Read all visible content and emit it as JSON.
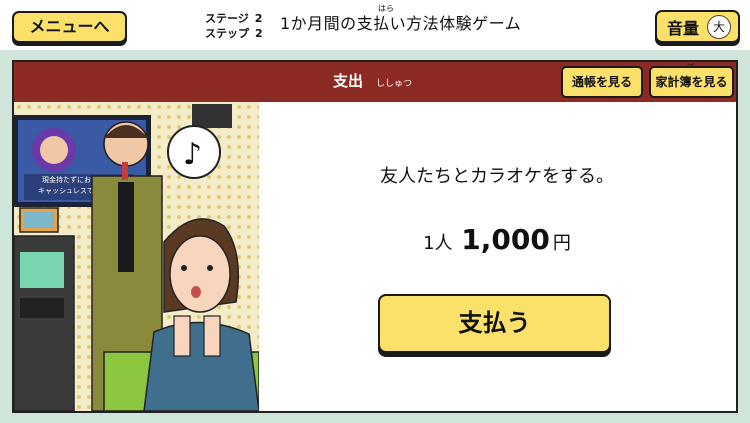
{
  "header": {
    "menu_label": "メニューへ",
    "stage_label": "ステージ",
    "stage_number": "2",
    "step_label": "ステップ",
    "step_number": "2",
    "title": "1か月間の支払い方法体験ゲーム",
    "title_ruby": "はら",
    "volume_label": "音量",
    "volume_value": "大"
  },
  "panel": {
    "title": "支出",
    "title_ruby": "ししゅつ",
    "passbook_label": "通帳を見る",
    "ledger_label": "家計簿を見る",
    "ledger_ruby": "ぼ"
  },
  "event": {
    "description": "友人たちとカラオケをする。",
    "per_person": "1人",
    "amount": "1,000",
    "currency": "円",
    "pay_label": "支払う"
  },
  "illustration": {
    "screen_caption_1": "現金持たずにお",
    "screen_caption_2": "キャッシュレスで",
    "music_note_icon": "music-note-icon"
  },
  "colors": {
    "accent_red": "#8c2a24",
    "button_yellow": "#fbe06a",
    "frame_green": "#cfe5da"
  }
}
